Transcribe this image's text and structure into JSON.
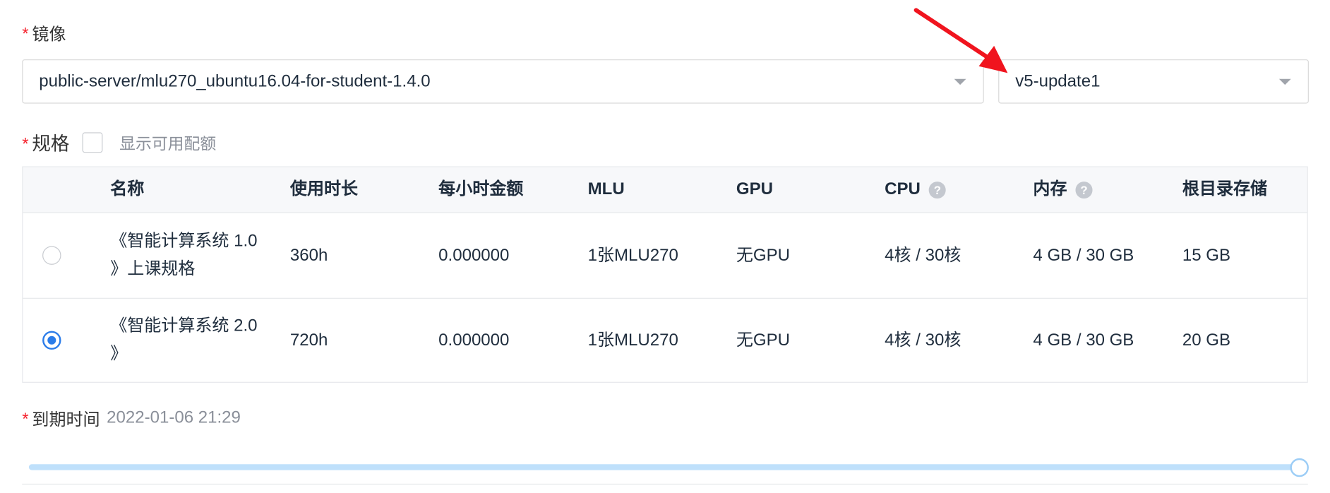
{
  "image_field": {
    "required_mark": "*",
    "label": "镜像",
    "image_select_value": "public-server/mlu270_ubuntu16.04-for-student-1.4.0",
    "tag_select_value": "v5-update1"
  },
  "spec_field": {
    "required_mark": "*",
    "label": "规格",
    "show_quota_label": "显示可用配额",
    "columns": [
      "名称",
      "使用时长",
      "每小时金额",
      "MLU",
      "GPU",
      "CPU",
      "内存",
      "根目录存储"
    ],
    "help_icon": "?",
    "rows": [
      {
        "selected": false,
        "name": "《智能计算系统 1.0 》上课规格",
        "duration": "360h",
        "hourly_price": "0.000000",
        "mlu": "1张MLU270",
        "gpu": "无GPU",
        "cpu": "4核 / 30核",
        "memory": "4 GB / 30 GB",
        "storage": "15 GB"
      },
      {
        "selected": true,
        "name": "《智能计算系统 2.0 》",
        "duration": "720h",
        "hourly_price": "0.000000",
        "mlu": "1张MLU270",
        "gpu": "无GPU",
        "cpu": "4核 / 30核",
        "memory": "4 GB / 30 GB",
        "storage": "20 GB"
      }
    ]
  },
  "expiry_field": {
    "required_mark": "*",
    "label": "到期时间",
    "value": "2022-01-06 21:29",
    "slider_level": 1.0
  },
  "colors": {
    "required": "#f5222d",
    "accent": "#2b7ce9",
    "slider_track": "#bfe0fb",
    "annotation_arrow": "#f0141e"
  },
  "icons": {
    "select_caret": "caret-down-icon",
    "help": "question-circle-icon",
    "annotation": "red-arrow-icon"
  }
}
